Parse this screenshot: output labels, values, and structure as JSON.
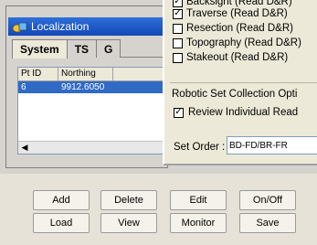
{
  "localization": {
    "title": "Localization",
    "tabs": [
      "System",
      "TS",
      "G"
    ],
    "columns": [
      "Pt ID",
      "Northing"
    ],
    "rows": [
      {
        "pt_id": "6",
        "northing": "9912.6050"
      }
    ]
  },
  "collection": {
    "checks": [
      {
        "label": "Backsight (Read D&R)",
        "checked": true
      },
      {
        "label": "Traverse (Read D&R)",
        "checked": true
      },
      {
        "label": "Resection (Read D&R)",
        "checked": false
      },
      {
        "label": "Topography (Read D&R)",
        "checked": false
      },
      {
        "label": "Stakeout (Read D&R)",
        "checked": false
      }
    ],
    "group_title": "Robotic Set Collection Opti",
    "review_label": "Review Individual Read",
    "review_checked": true,
    "set_order_label": "Set Order :",
    "set_order_value": "BD-FD/BR-FR"
  },
  "buttons": {
    "add": "Add",
    "delete": "Delete",
    "edit": "Edit",
    "onoff": "On/Off",
    "load": "Load",
    "view": "View",
    "monitor": "Monitor",
    "save": "Save"
  },
  "colors": {
    "titlebar": "#1f5fd0",
    "selection": "#316ac5",
    "dialog_bg": "#ece9d8"
  }
}
